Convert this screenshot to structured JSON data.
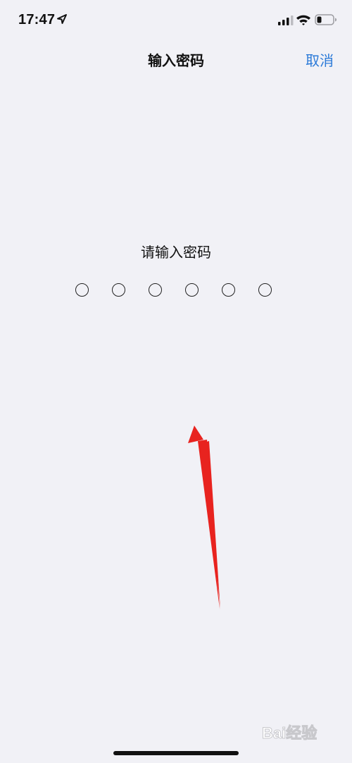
{
  "status_bar": {
    "time": "17:47",
    "icons": [
      "location-arrow-icon",
      "cellular-signal-icon",
      "wifi-icon",
      "battery-icon"
    ]
  },
  "nav": {
    "title": "输入密码",
    "cancel_label": "取消"
  },
  "passcode": {
    "prompt": "请输入密码",
    "digit_count": 6,
    "entered_count": 0
  },
  "watermark": {
    "text": "Bai经验"
  },
  "colors": {
    "background": "#f1f1f6",
    "accent": "#2b7ad8",
    "annotation_arrow": "#e8231f"
  }
}
